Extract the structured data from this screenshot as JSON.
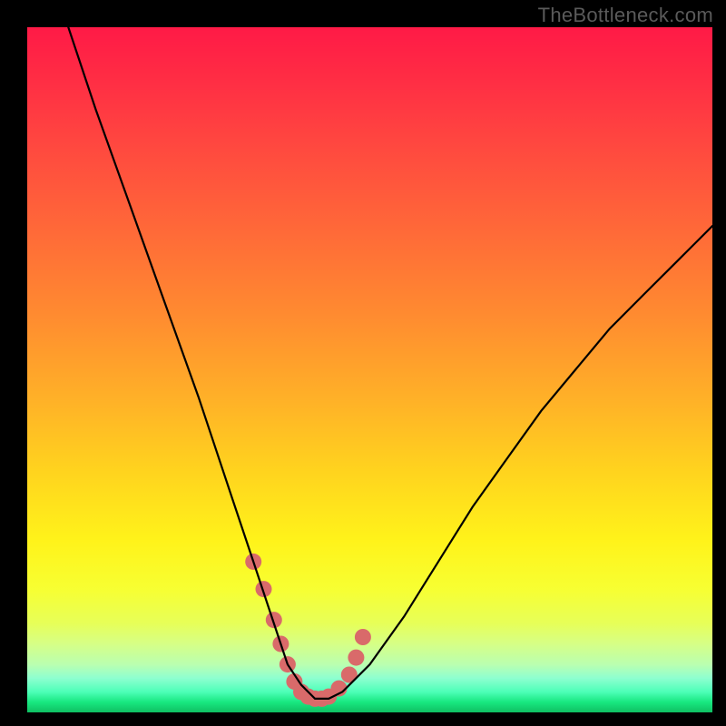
{
  "watermark": "TheBottleneck.com",
  "chart_data": {
    "type": "line",
    "title": "",
    "xlabel": "",
    "ylabel": "",
    "xlim": [
      0,
      100
    ],
    "ylim": [
      0,
      100
    ],
    "series": [
      {
        "name": "bottleneck-curve",
        "x": [
          6,
          10,
          15,
          20,
          25,
          30,
          33,
          36,
          38,
          40,
          42,
          44,
          46,
          50,
          55,
          60,
          65,
          70,
          75,
          80,
          85,
          90,
          95,
          100
        ],
        "values": [
          100,
          88,
          74,
          60,
          46,
          31,
          22,
          13,
          7,
          4,
          2,
          2,
          3,
          7,
          14,
          22,
          30,
          37,
          44,
          50,
          56,
          61,
          66,
          71
        ]
      }
    ],
    "markers": {
      "name": "highlight-dots",
      "x": [
        33.0,
        34.5,
        36.0,
        37.0,
        38.0,
        39.0,
        40.0,
        41.0,
        42.0,
        43.0,
        44.0,
        45.5,
        47.0,
        48.0,
        49.0
      ],
      "values": [
        22.0,
        18.0,
        13.5,
        10.0,
        7.0,
        4.5,
        3.0,
        2.3,
        2.0,
        2.0,
        2.3,
        3.5,
        5.5,
        8.0,
        11.0
      ]
    },
    "colors": {
      "curve": "#000000",
      "markers": "#d96a6a",
      "gradient_top": "#ff1a46",
      "gradient_bottom": "#0fbf62"
    }
  }
}
